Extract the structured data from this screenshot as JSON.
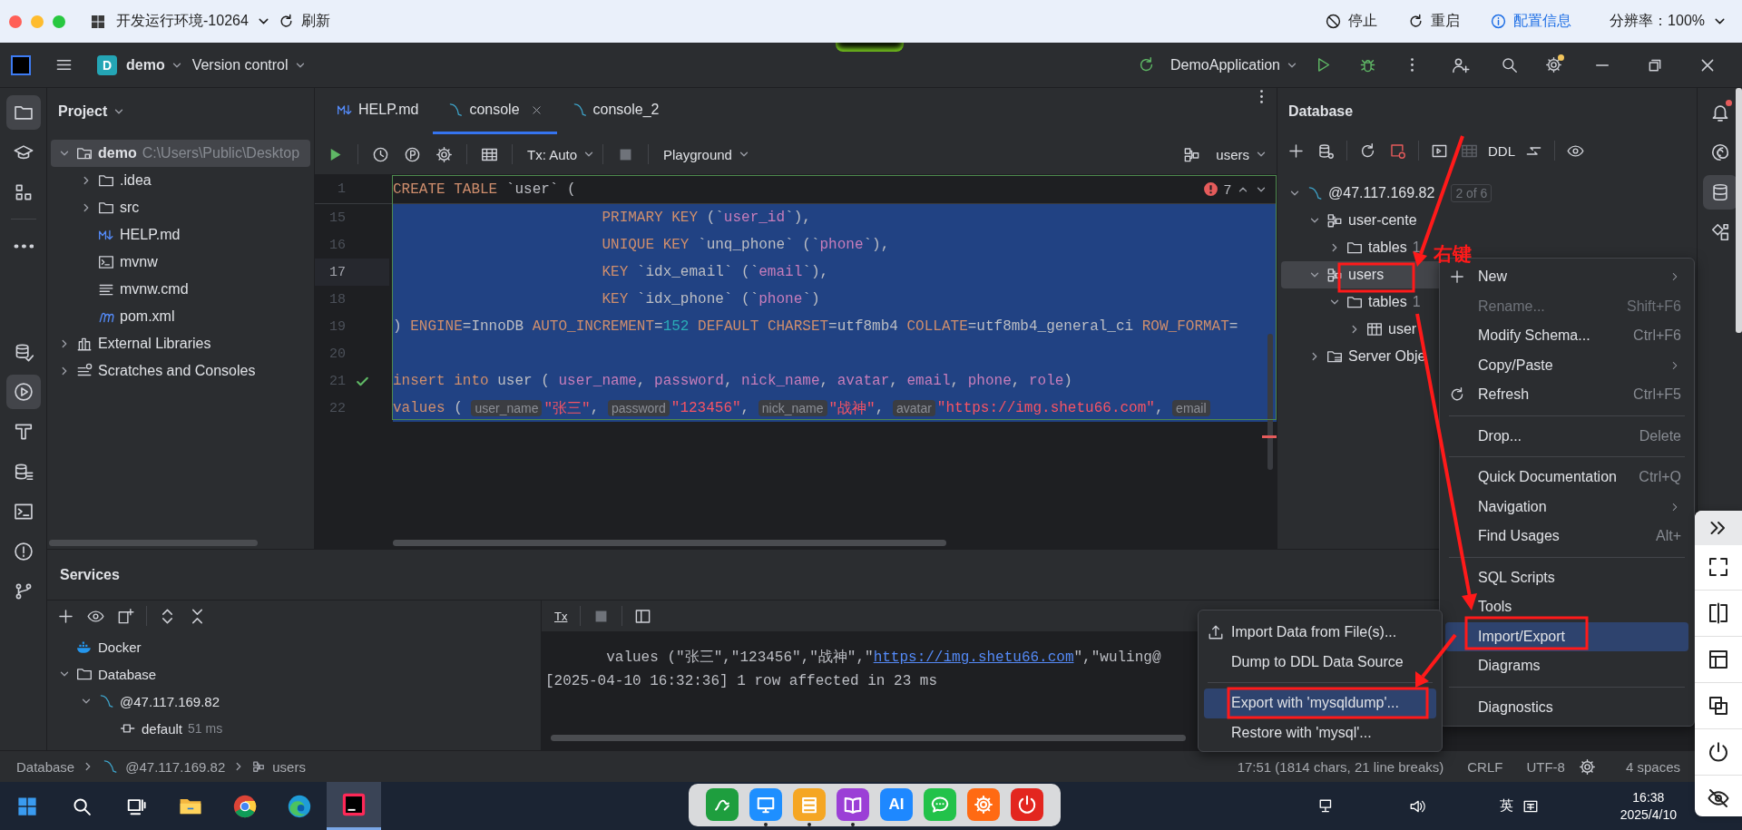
{
  "remote_bar": {
    "title": "开发运行环境-10264",
    "refresh": "刷新",
    "stop": "停止",
    "restart": "重启",
    "config": "配置信息",
    "resolution": "分辨率：100%"
  },
  "title_bar": {
    "project_badge": "D",
    "project": "demo",
    "vcs": "Version control",
    "run_config": "DemoApplication",
    "settings_badge": true
  },
  "left_tools": [
    {
      "kind": "folder",
      "selected": true
    },
    {
      "kind": "learn",
      "selected": false
    },
    {
      "kind": "structure",
      "selected": false
    },
    {
      "kind": "more",
      "selected": false
    }
  ],
  "left_tools_bottom": [
    {
      "kind": "dbcheck",
      "selected": false
    },
    {
      "kind": "services",
      "selected": true
    },
    {
      "kind": "build",
      "selected": false
    },
    {
      "kind": "dblist",
      "selected": false
    },
    {
      "kind": "terminal",
      "selected": false
    },
    {
      "kind": "problems",
      "selected": false
    },
    {
      "kind": "git",
      "selected": false
    }
  ],
  "right_tools": [
    {
      "kind": "bell",
      "alert": true,
      "selected": false
    },
    {
      "kind": "spiral",
      "alert": false,
      "selected": false
    },
    {
      "kind": "database",
      "alert": false,
      "selected": true
    },
    {
      "kind": "puzzle",
      "alert": false,
      "selected": false
    }
  ],
  "project_panel": {
    "title": "Project",
    "tree": [
      {
        "name": "demo",
        "path": "C:\\Users\\Public\\Desktop",
        "kind": "module",
        "expanded": true,
        "selected": true,
        "children": [
          {
            "name": ".idea",
            "kind": "folder",
            "expanded": false,
            "selected": false
          },
          {
            "name": "src",
            "kind": "folder",
            "expanded": false,
            "selected": false
          },
          {
            "name": "HELP.md",
            "kind": "markdown",
            "selected": false
          },
          {
            "name": "mvnw",
            "kind": "shell",
            "selected": false
          },
          {
            "name": "mvnw.cmd",
            "kind": "text",
            "selected": false
          },
          {
            "name": "pom.xml",
            "kind": "maven",
            "selected": false
          }
        ]
      },
      {
        "name": "External Libraries",
        "kind": "library",
        "expanded": false,
        "selected": false
      },
      {
        "name": "Scratches and Consoles",
        "kind": "scratch",
        "expanded": false,
        "selected": false
      }
    ]
  },
  "editor": {
    "tabs": [
      {
        "label": "HELP.md",
        "kind": "markdown",
        "selected": false
      },
      {
        "label": "console",
        "kind": "console",
        "selected": true
      },
      {
        "label": "console_2",
        "kind": "console",
        "selected": false
      }
    ],
    "toolbar": {
      "tx": "Tx: Auto",
      "mode": "Playground",
      "schema": "users"
    },
    "problems": "7",
    "sticky_line": {
      "number": "1",
      "tokens": [
        {
          "text": "CREATE TABLE ",
          "kind": "kw"
        },
        {
          "text": "`user` (",
          "kind": "id"
        }
      ]
    },
    "lines": [
      {
        "number": "15",
        "current": false,
        "selected": true,
        "indented": true,
        "tokens": [
          {
            "text": "PRIMARY KEY ",
            "kind": "kw"
          },
          {
            "text": "(`",
            "kind": "id"
          },
          {
            "text": "user_id",
            "kind": "field"
          },
          {
            "text": "`),",
            "kind": "id"
          }
        ]
      },
      {
        "number": "16",
        "current": false,
        "selected": true,
        "indented": true,
        "tokens": [
          {
            "text": "UNIQUE KEY ",
            "kind": "kw"
          },
          {
            "text": "`unq_phone` (`",
            "kind": "id"
          },
          {
            "text": "phone",
            "kind": "field"
          },
          {
            "text": "`),",
            "kind": "id"
          }
        ]
      },
      {
        "number": "17",
        "current": true,
        "selected": true,
        "indented": true,
        "tokens": [
          {
            "text": "KEY ",
            "kind": "kw"
          },
          {
            "text": "`idx_email` (`",
            "kind": "id"
          },
          {
            "text": "email",
            "kind": "field"
          },
          {
            "text": "`),",
            "kind": "id"
          }
        ]
      },
      {
        "number": "18",
        "current": false,
        "selected": true,
        "indented": true,
        "tokens": [
          {
            "text": "KEY ",
            "kind": "kw"
          },
          {
            "text": "`idx_phone` (`",
            "kind": "id"
          },
          {
            "text": "phone",
            "kind": "field"
          },
          {
            "text": "`)",
            "kind": "id"
          }
        ]
      },
      {
        "number": "19",
        "current": false,
        "selected": true,
        "indented": false,
        "tokens": [
          {
            "text": ") ",
            "kind": "id"
          },
          {
            "text": "ENGINE",
            "kind": "kw"
          },
          {
            "text": "=InnoDB ",
            "kind": "id"
          },
          {
            "text": "AUTO_INCREMENT",
            "kind": "kw"
          },
          {
            "text": "=",
            "kind": "id"
          },
          {
            "text": "152",
            "kind": "num"
          },
          {
            "text": " DEFAULT CHARSET",
            "kind": "kw"
          },
          {
            "text": "=utf8mb4 ",
            "kind": "id"
          },
          {
            "text": "COLLATE",
            "kind": "kw"
          },
          {
            "text": "=utf8mb4_general_ci ",
            "kind": "id"
          },
          {
            "text": "ROW_FORMAT",
            "kind": "kw"
          },
          {
            "text": "=",
            "kind": "id"
          }
        ]
      },
      {
        "number": "20",
        "current": false,
        "selected": true
      },
      {
        "number": "21",
        "current": false,
        "ok": true,
        "selected": true,
        "indented": false,
        "tokens": [
          {
            "text": "insert into ",
            "kind": "kw"
          },
          {
            "text": "user ( ",
            "kind": "id"
          },
          {
            "text": "user_name",
            "kind": "field"
          },
          {
            "text": ", ",
            "kind": "id"
          },
          {
            "text": "password",
            "kind": "field"
          },
          {
            "text": ", ",
            "kind": "id"
          },
          {
            "text": "nick_name",
            "kind": "field"
          },
          {
            "text": ", ",
            "kind": "id"
          },
          {
            "text": "avatar",
            "kind": "field"
          },
          {
            "text": ", ",
            "kind": "id"
          },
          {
            "text": "email",
            "kind": "field"
          },
          {
            "text": ", ",
            "kind": "id"
          },
          {
            "text": "phone",
            "kind": "field"
          },
          {
            "text": ", ",
            "kind": "id"
          },
          {
            "text": "role",
            "kind": "field"
          },
          {
            "text": ")",
            "kind": "id"
          }
        ]
      },
      {
        "number": "22",
        "current": false,
        "selected": true,
        "indented": false,
        "tokens": [
          {
            "text": "values ",
            "kind": "kw"
          },
          {
            "text": "( ",
            "kind": "id"
          },
          {
            "text": "user_name",
            "kind": "hint"
          },
          {
            "text": "\"张三\"",
            "kind": "str"
          },
          {
            "text": ", ",
            "kind": "id"
          },
          {
            "text": "password",
            "kind": "hint"
          },
          {
            "text": "\"123456\"",
            "kind": "str"
          },
          {
            "text": ", ",
            "kind": "id"
          },
          {
            "text": "nick_name",
            "kind": "hint"
          },
          {
            "text": "\"战神\"",
            "kind": "str"
          },
          {
            "text": ", ",
            "kind": "id"
          },
          {
            "text": "avatar",
            "kind": "hint"
          },
          {
            "text": "\"https://img.shetu66.com\"",
            "kind": "str"
          },
          {
            "text": ", ",
            "kind": "id"
          },
          {
            "text": "email",
            "kind": "hint"
          }
        ]
      }
    ]
  },
  "database_panel": {
    "title": "Database",
    "ddl": "DDL",
    "tree": [
      {
        "name": "@47.117.169.82",
        "badge": "2 of 6",
        "kind": "connection",
        "expanded": true,
        "selected": false,
        "children": [
          {
            "name": "user-cente",
            "kind": "schema",
            "expanded": true,
            "selected": false,
            "children": [
              {
                "name": "tables",
                "count": "1",
                "kind": "folder",
                "expanded": false,
                "selected": false
              }
            ]
          },
          {
            "name": "users",
            "kind": "schema",
            "expanded": true,
            "selected": true,
            "children": [
              {
                "name": "tables",
                "count": "1",
                "kind": "folder",
                "expanded": true,
                "selected": false,
                "children": [
                  {
                    "name": "user",
                    "kind": "table",
                    "expanded": false,
                    "selected": false
                  }
                ]
              }
            ]
          },
          {
            "name": "Server Obje",
            "kind": "server",
            "expanded": false,
            "selected": false
          }
        ]
      }
    ]
  },
  "context_menu": [
    {
      "kind": "item",
      "label": "New",
      "submenu": true,
      "disabled": false,
      "selected": false
    },
    {
      "kind": "item",
      "label": "Rename...",
      "shortcut": "Shift+F6",
      "submenu": false,
      "disabled": true,
      "selected": false
    },
    {
      "kind": "item",
      "label": "Modify Schema...",
      "shortcut": "Ctrl+F6",
      "submenu": false,
      "disabled": false,
      "selected": false
    },
    {
      "kind": "item",
      "label": "Copy/Paste",
      "submenu": true,
      "disabled": false,
      "selected": false
    },
    {
      "kind": "item",
      "label": "Refresh",
      "shortcut": "Ctrl+F5",
      "submenu": false,
      "disabled": false,
      "selected": false
    },
    {
      "kind": "separator"
    },
    {
      "kind": "item",
      "label": "Drop...",
      "shortcut": "Delete",
      "submenu": false,
      "disabled": false,
      "selected": false
    },
    {
      "kind": "separator"
    },
    {
      "kind": "item",
      "label": "Quick Documentation",
      "shortcut": "Ctrl+Q",
      "submenu": false,
      "disabled": false,
      "selected": false
    },
    {
      "kind": "item",
      "label": "Navigation",
      "submenu": true,
      "disabled": false,
      "selected": false
    },
    {
      "kind": "item",
      "label": "Find Usages",
      "shortcut": "Alt+",
      "submenu": false,
      "disabled": false,
      "selected": false
    },
    {
      "kind": "separator"
    },
    {
      "kind": "item",
      "label": "SQL Scripts",
      "submenu": false,
      "disabled": false,
      "selected": false
    },
    {
      "kind": "item",
      "label": "Tools",
      "submenu": false,
      "disabled": false,
      "selected": false
    },
    {
      "kind": "item",
      "label": "Import/Export",
      "submenu": false,
      "disabled": false,
      "selected": true
    },
    {
      "kind": "item",
      "label": "Diagrams",
      "submenu": false,
      "disabled": false,
      "selected": false
    },
    {
      "kind": "separator"
    },
    {
      "kind": "item",
      "label": "Diagnostics",
      "submenu": false,
      "disabled": false,
      "selected": false
    }
  ],
  "submenu": [
    {
      "kind": "item",
      "label": "Import Data from File(s)...",
      "selected": false
    },
    {
      "kind": "item",
      "label": "Dump to DDL Data Source",
      "selected": false
    },
    {
      "kind": "separator"
    },
    {
      "kind": "item",
      "label": "Export with 'mysqldump'...",
      "selected": true
    },
    {
      "kind": "item",
      "label": "Restore with 'mysql'...",
      "selected": false
    }
  ],
  "services": {
    "title": "Services",
    "tree": [
      {
        "name": "Docker",
        "kind": "docker",
        "selected": false
      },
      {
        "name": "Database",
        "kind": "folder",
        "expanded": true,
        "selected": false,
        "children": [
          {
            "name": "@47.117.169.82",
            "kind": "connection",
            "expanded": true,
            "selected": false,
            "children": [
              {
                "name": "default",
                "kind": "session",
                "time": "51 ms",
                "selected": false
              }
            ]
          }
        ]
      }
    ],
    "console_tool": "Tx",
    "console": [
      {
        "parts": [
          {
            "text": "       values (\"张三\",\"123456\",\"战神\",\"",
            "kind": "plain"
          },
          {
            "text": "https://img.shetu66.com",
            "kind": "link"
          },
          {
            "text": "\",\"wuling@",
            "kind": "plain"
          }
        ]
      },
      {
        "parts": [
          {
            "text": "[2025-04-10 16:32:36] 1 row affected in 23 ms",
            "kind": "plain"
          }
        ]
      }
    ]
  },
  "status_bar": {
    "breadcrumbs": [
      {
        "label": "Database",
        "kind": "plain"
      },
      {
        "label": "@47.117.169.82",
        "kind": "connection"
      },
      {
        "label": "users",
        "kind": "schema"
      }
    ],
    "position": "17:51 (1814 chars, 21 line breaks)",
    "line_ending": "CRLF",
    "encoding": "UTF-8",
    "indent": "4 spaces"
  },
  "annotation": {
    "label": "右键"
  },
  "taskbar": {
    "apps": [
      {
        "kind": "start",
        "selected": false
      },
      {
        "kind": "search",
        "selected": false
      },
      {
        "kind": "taskview",
        "selected": false
      },
      {
        "kind": "explorer",
        "selected": false
      },
      {
        "kind": "chrome",
        "selected": false
      },
      {
        "kind": "edge",
        "selected": false
      },
      {
        "kind": "ide",
        "selected": true
      }
    ],
    "dock": [
      {
        "kind": "pen",
        "color": "#1e9e3e",
        "running": false
      },
      {
        "kind": "monitor",
        "color": "#1e8fff",
        "running": true
      },
      {
        "kind": "stack",
        "color": "#f5a623",
        "running": true
      },
      {
        "kind": "book",
        "color": "#9b3fd6",
        "running": true
      },
      {
        "kind": "text",
        "label": "AI",
        "color": "#1e88ff",
        "running": false
      },
      {
        "kind": "chat",
        "color": "#22c24a",
        "running": false
      },
      {
        "kind": "gear",
        "color": "#ff6a13",
        "running": false
      },
      {
        "kind": "power",
        "color": "#e3261f",
        "running": false
      }
    ],
    "ime": "英",
    "time": "16:38",
    "date": "2025/4/10"
  }
}
